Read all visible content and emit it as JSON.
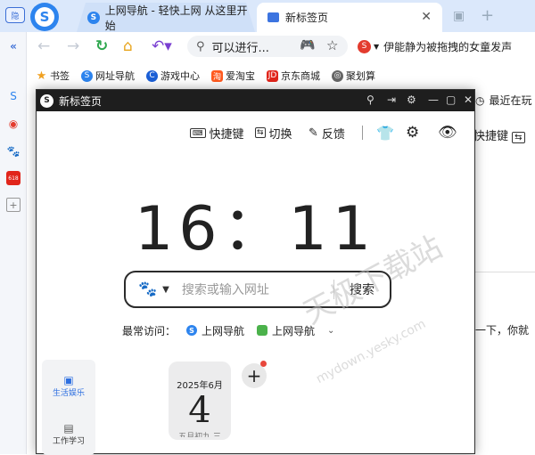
{
  "browser": {
    "tabs": [
      {
        "label": "上网导航 - 轻快上网 从这里开始"
      },
      {
        "label": "新标签页"
      }
    ],
    "url_text": "可以进行...",
    "search_text": "伊能静为被拖拽的女童发声",
    "sidebar_toggle_label": "隐"
  },
  "bookmarks": [
    {
      "label": "书签",
      "icon": "star-icon"
    },
    {
      "label": "网址导航",
      "icon": "browser-logo-icon"
    },
    {
      "label": "游戏中心",
      "icon": "game-center-icon"
    },
    {
      "label": "爱淘宝",
      "icon": "taobao-icon"
    },
    {
      "label": "京东商城",
      "icon": "jd-icon"
    },
    {
      "label": "聚划算",
      "icon": "juhuasuan-icon"
    }
  ],
  "window": {
    "title": "新标签页",
    "toolbar": {
      "shortcut": "快捷键",
      "switch": "切换",
      "feedback": "反馈"
    },
    "clock": "16：11",
    "search": {
      "placeholder": "搜索或输入网址",
      "button": "搜索"
    },
    "recent": {
      "label": "最常访问：",
      "sites": [
        "上网导航",
        "上网导航"
      ]
    },
    "categories": [
      "生活娱乐",
      "工作学习"
    ],
    "date_card": {
      "month": "2025年6月",
      "day": "4",
      "lunar": "五月初九 三"
    }
  },
  "background": {
    "recent_play": "最近在玩",
    "shortcut": "快捷键",
    "tip": "一下，你就"
  },
  "watermark": {
    "main": "天极下载站",
    "sub": "mydown.yesky.com"
  },
  "colors": {
    "accent": "#2d84ee",
    "tabbar": "#dbe8fb",
    "window_title": "#1e1e1e"
  }
}
